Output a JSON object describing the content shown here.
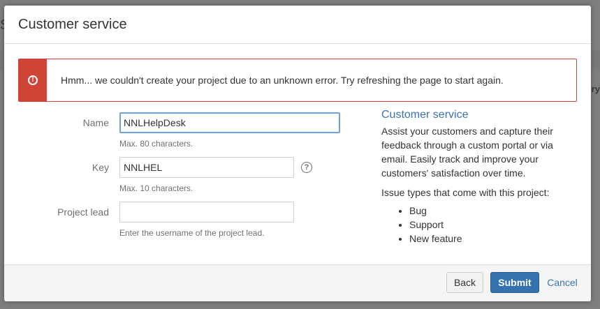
{
  "background": {
    "left_glyph": "S",
    "right_text": "ry"
  },
  "dialog": {
    "title": "Customer service",
    "error": {
      "icon": "exclamation-icon",
      "message": "Hmm... we couldn't create your project due to an unknown error. Try refreshing the page to start again."
    },
    "form": {
      "name": {
        "label": "Name",
        "value": "NNLHelpDesk",
        "description": "Max. 80 characters."
      },
      "key": {
        "label": "Key",
        "value": "NNLHEL",
        "description": "Max. 10 characters.",
        "help_icon": "?"
      },
      "project_lead": {
        "label": "Project lead",
        "value": "",
        "description": "Enter the username of the project lead."
      }
    },
    "info": {
      "title": "Customer service",
      "description": "Assist your customers and capture their feedback through a custom portal or via email. Easily track and improve your customers' satisfaction over time.",
      "issue_types_heading": "Issue types that come with this project:",
      "issue_types": [
        "Bug",
        "Support",
        "New feature"
      ]
    },
    "footer": {
      "back_label": "Back",
      "submit_label": "Submit",
      "cancel_label": "Cancel"
    }
  },
  "colors": {
    "error": "#d04437",
    "primary": "#3572b0",
    "link": "#3b73af",
    "focus": "#6fa2d9"
  }
}
